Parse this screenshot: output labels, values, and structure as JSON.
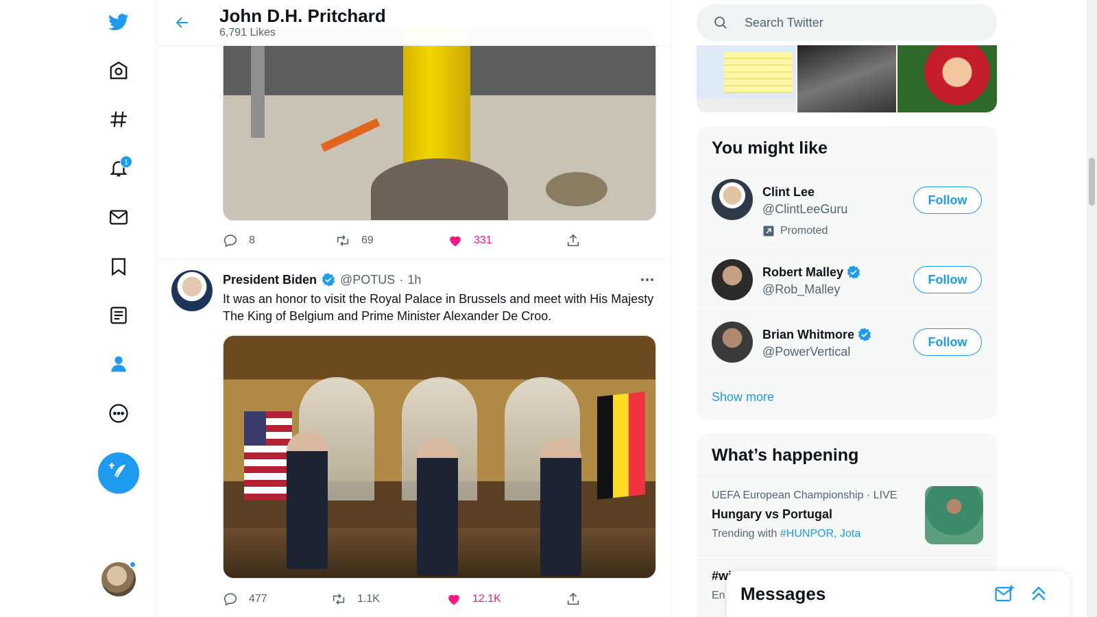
{
  "nav": {
    "items": [
      {
        "name": "twitter-logo-icon"
      },
      {
        "name": "home-icon"
      },
      {
        "name": "explore-hashtag-icon"
      },
      {
        "name": "notifications-bell-icon",
        "badge": "1"
      },
      {
        "name": "messages-mail-icon"
      },
      {
        "name": "bookmarks-icon"
      },
      {
        "name": "lists-icon"
      },
      {
        "name": "profile-icon"
      },
      {
        "name": "more-icon"
      }
    ],
    "compose_icon": "compose-tweet-icon"
  },
  "header": {
    "title": "John D.H. Pritchard",
    "subtitle": "6,791 Likes"
  },
  "tweet1": {
    "replies": "8",
    "retweets": "69",
    "likes": "331",
    "liked": true
  },
  "tweet2": {
    "name": "President Biden",
    "handle": "@POTUS",
    "dot": "·",
    "time": "1h",
    "text": "It was an honor to visit the Royal Palace in Brussels and meet with His Majesty The King of Belgium and Prime Minister Alexander De Croo.",
    "replies": "477",
    "retweets": "1.1K",
    "likes": "12.1K",
    "liked": true
  },
  "search": {
    "placeholder": "Search Twitter"
  },
  "who_to_follow": {
    "title": "You might like",
    "users": [
      {
        "name": "Clint Lee",
        "handle": "@ClintLeeGuru",
        "verified": false,
        "promoted": "Promoted",
        "follow": "Follow"
      },
      {
        "name": "Robert Malley",
        "handle": "@Rob_Malley",
        "verified": true,
        "follow": "Follow"
      },
      {
        "name": "Brian Whitmore",
        "handle": "@PowerVertical",
        "verified": true,
        "follow": "Follow"
      }
    ],
    "show_more": "Show more"
  },
  "trends": {
    "title": "What’s happening",
    "items": [
      {
        "meta": "UEFA European Championship · LIVE",
        "title": "Hungary vs Portugal",
        "with_label": "Trending with",
        "with_links": "#HUNPOR, Jota"
      }
    ],
    "partial_title": "#wi",
    "partial_meta": "En"
  },
  "messages": {
    "title": "Messages"
  },
  "colors": {
    "accent": "#1d9bf0",
    "like": "#f91880",
    "text": "#0f1419",
    "muted": "#536471"
  }
}
